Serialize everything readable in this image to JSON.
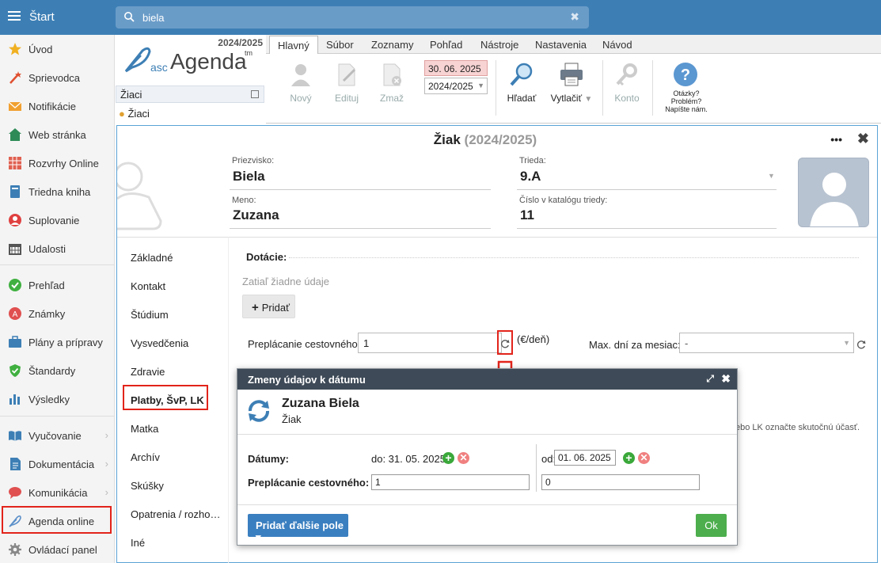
{
  "topbar": {
    "title": "Štart",
    "search_value": "biela",
    "clear": "✖"
  },
  "sidebar": {
    "items": [
      {
        "label": "Úvod",
        "icon": "star-icon",
        "color": "#f0b020"
      },
      {
        "label": "Sprievodca",
        "icon": "wand-icon",
        "color": "#e05030"
      },
      {
        "label": "Notifikácie",
        "icon": "envelope-icon",
        "color": "#f0a030"
      },
      {
        "label": "Web stránka",
        "icon": "home-icon",
        "color": "#2e8b57"
      },
      {
        "label": "Rozvrhy Online",
        "icon": "grid-icon",
        "color": "#e06050"
      },
      {
        "label": "Triedna kniha",
        "icon": "book-icon",
        "color": "#3d7fb5"
      },
      {
        "label": "Suplovanie",
        "icon": "person-icon",
        "color": "#e04040"
      },
      {
        "label": "Udalosti",
        "icon": "calendar-icon",
        "color": "#555"
      },
      {
        "label": "Prehľad",
        "icon": "check-circle-icon",
        "color": "#40b040"
      },
      {
        "label": "Známky",
        "icon": "grade-icon",
        "color": "#e05050"
      },
      {
        "label": "Plány a prípravy",
        "icon": "briefcase-icon",
        "color": "#3d7fb5"
      },
      {
        "label": "Štandardy",
        "icon": "shield-check-icon",
        "color": "#40b040"
      },
      {
        "label": "Výsledky",
        "icon": "bar-chart-icon",
        "color": "#3d7fb5"
      },
      {
        "label": "Vyučovanie",
        "icon": "open-book-icon",
        "color": "#3d7fb5"
      },
      {
        "label": "Dokumentácia",
        "icon": "document-icon",
        "color": "#3d7fb5"
      },
      {
        "label": "Komunikácia",
        "icon": "chat-icon",
        "color": "#e05050"
      },
      {
        "label": "Agenda online",
        "icon": "feather-icon",
        "color": "#5a8fc8"
      },
      {
        "label": "Ovládací panel",
        "icon": "gear-icon",
        "color": "#888"
      }
    ],
    "chevron": "›"
  },
  "agenda": {
    "year": "2024/2025",
    "logo_asc": "asc",
    "logo_agenda": "Agenda",
    "logo_tm": "tm",
    "panel_title": "Žiaci",
    "panel_item": "Žiaci"
  },
  "menu": {
    "tabs": [
      "Hlavný",
      "Súbor",
      "Zoznamy",
      "Pohľad",
      "Nástroje",
      "Nastavenia",
      "Návod"
    ]
  },
  "ribbon": {
    "new": "Nový",
    "edit": "Edituj",
    "delete": "Zmaž",
    "date": "30. 06. 2025",
    "year_select": "2024/2025",
    "search": "Hľadať",
    "print": "Vytlačiť",
    "account": "Konto",
    "help": "Otázky? Problém? Napíšte nám."
  },
  "card": {
    "title": "Žiak",
    "title_year": "(2024/2025)",
    "dots": "•••",
    "close": "✖",
    "surname_label": "Priezvisko:",
    "surname": "Biela",
    "name_label": "Meno:",
    "name": "Zuzana",
    "class_label": "Trieda:",
    "class": "9.A",
    "catalog_label": "Číslo v katalógu triedy:",
    "catalog": "11",
    "tabs": [
      "Základné",
      "Kontakt",
      "Štúdium",
      "Vysvedčenia",
      "Zdravie",
      "Platby, ŠvP, LK",
      "Matka",
      "Archív",
      "Skúšky",
      "Opatrenia / rozho…",
      "Iné"
    ],
    "section": "Dotácie:",
    "empty": "Zatiaľ žiadne údaje",
    "add": "Pridať",
    "travel_label": "Preplácanie cestovného:",
    "travel_value": "1",
    "unit": "(€/deň)",
    "maxdays_label": "Max. dní za mesiac:",
    "maxdays_value": "-",
    "hint": "ebo LK označte skutočnú účasť."
  },
  "modal": {
    "title": "Zmeny údajov k dátumu",
    "name": "Zuzana Biela",
    "role": "Žiak",
    "dates_label": "Dátumy:",
    "do_label": "do: 31. 05. 2025",
    "od_label": "od:",
    "od_value": "01. 06. 2025",
    "travel_label": "Preplácanie cestovného:",
    "value_left": "1",
    "value_right": "0",
    "more": "Pridať ďalšie pole ▾",
    "ok": "Ok"
  }
}
